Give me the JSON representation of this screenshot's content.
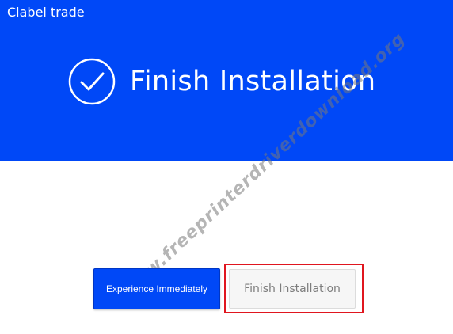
{
  "window": {
    "title": "Clabel trade"
  },
  "header": {
    "title": "Finish Installation",
    "icon": "check-circle-icon",
    "background_color": "#0048f7"
  },
  "watermark": {
    "text": "www.freeprinterdriverdownload.org"
  },
  "actions": {
    "experience_label": "Experience Immediately",
    "finish_label": "Finish Installation",
    "highlight_color": "#e0161f"
  }
}
